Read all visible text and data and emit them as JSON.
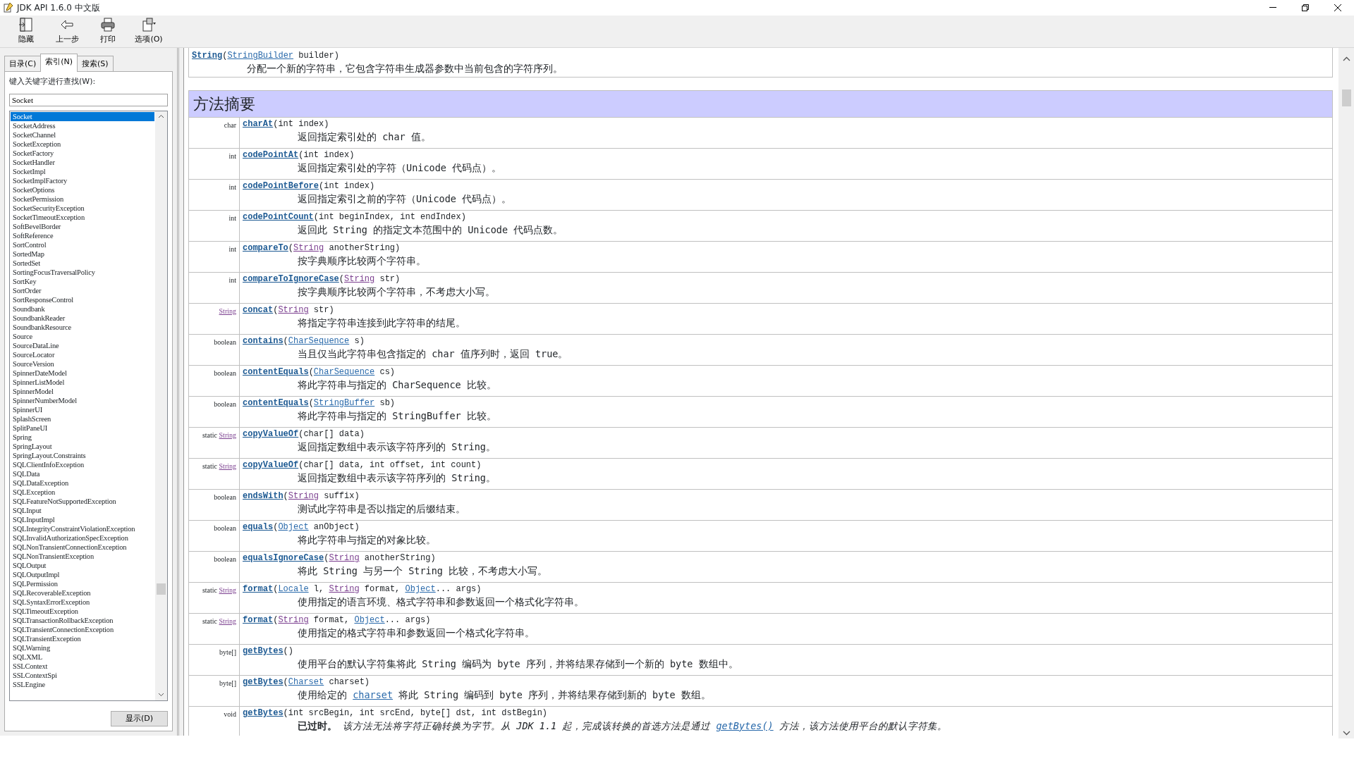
{
  "window": {
    "title": "JDK API 1.6.0 中文版"
  },
  "toolbar": [
    {
      "label": "隐藏",
      "kind": "hide"
    },
    {
      "label": "上一步",
      "kind": "back"
    },
    {
      "label": "打印",
      "kind": "print"
    },
    {
      "label": "选项(O)",
      "kind": "options"
    }
  ],
  "tabs": [
    {
      "label": "目录(C)",
      "selected": false
    },
    {
      "label": "索引(N)",
      "selected": true
    },
    {
      "label": "搜索(S)",
      "selected": false
    }
  ],
  "search": {
    "label": "键入关键字进行查找(W):",
    "value": "Socket"
  },
  "index_list": [
    {
      "label": "Socket",
      "selected": true
    },
    {
      "label": "SocketAddress",
      "selected": false
    },
    {
      "label": "SocketChannel",
      "selected": false
    },
    {
      "label": "SocketException",
      "selected": false
    },
    {
      "label": "SocketFactory",
      "selected": false
    },
    {
      "label": "SocketHandler",
      "selected": false
    },
    {
      "label": "SocketImpl",
      "selected": false
    },
    {
      "label": "SocketImplFactory",
      "selected": false
    },
    {
      "label": "SocketOptions",
      "selected": false
    },
    {
      "label": "SocketPermission",
      "selected": false
    },
    {
      "label": "SocketSecurityException",
      "selected": false
    },
    {
      "label": "SocketTimeoutException",
      "selected": false
    },
    {
      "label": "SoftBevelBorder",
      "selected": false
    },
    {
      "label": "SoftReference",
      "selected": false
    },
    {
      "label": "SortControl",
      "selected": false
    },
    {
      "label": "SortedMap",
      "selected": false
    },
    {
      "label": "SortedSet",
      "selected": false
    },
    {
      "label": "SortingFocusTraversalPolicy",
      "selected": false
    },
    {
      "label": "SortKey",
      "selected": false
    },
    {
      "label": "SortOrder",
      "selected": false
    },
    {
      "label": "SortResponseControl",
      "selected": false
    },
    {
      "label": "Soundbank",
      "selected": false
    },
    {
      "label": "SoundbankReader",
      "selected": false
    },
    {
      "label": "SoundbankResource",
      "selected": false
    },
    {
      "label": "Source",
      "selected": false
    },
    {
      "label": "SourceDataLine",
      "selected": false
    },
    {
      "label": "SourceLocator",
      "selected": false
    },
    {
      "label": "SourceVersion",
      "selected": false
    },
    {
      "label": "SpinnerDateModel",
      "selected": false
    },
    {
      "label": "SpinnerListModel",
      "selected": false
    },
    {
      "label": "SpinnerModel",
      "selected": false
    },
    {
      "label": "SpinnerNumberModel",
      "selected": false
    },
    {
      "label": "SpinnerUI",
      "selected": false
    },
    {
      "label": "SplashScreen",
      "selected": false
    },
    {
      "label": "SplitPaneUI",
      "selected": false
    },
    {
      "label": "Spring",
      "selected": false
    },
    {
      "label": "SpringLayout",
      "selected": false
    },
    {
      "label": "SpringLayout.Constraints",
      "selected": false
    },
    {
      "label": "SQLClientInfoException",
      "selected": false
    },
    {
      "label": "SQLData",
      "selected": false
    },
    {
      "label": "SQLDataException",
      "selected": false
    },
    {
      "label": "SQLException",
      "selected": false
    },
    {
      "label": "SQLFeatureNotSupportedException",
      "selected": false
    },
    {
      "label": "SQLInput",
      "selected": false
    },
    {
      "label": "SQLInputImpl",
      "selected": false
    },
    {
      "label": "SQLIntegrityConstraintViolationException",
      "selected": false
    },
    {
      "label": "SQLInvalidAuthorizationSpecException",
      "selected": false
    },
    {
      "label": "SQLNonTransientConnectionException",
      "selected": false
    },
    {
      "label": "SQLNonTransientException",
      "selected": false
    },
    {
      "label": "SQLOutput",
      "selected": false
    },
    {
      "label": "SQLOutputImpl",
      "selected": false
    },
    {
      "label": "SQLPermission",
      "selected": false
    },
    {
      "label": "SQLRecoverableException",
      "selected": false
    },
    {
      "label": "SQLSyntaxErrorException",
      "selected": false
    },
    {
      "label": "SQLTimeoutException",
      "selected": false
    },
    {
      "label": "SQLTransactionRollbackException",
      "selected": false
    },
    {
      "label": "SQLTransientConnectionException",
      "selected": false
    },
    {
      "label": "SQLTransientException",
      "selected": false
    },
    {
      "label": "SQLWarning",
      "selected": false
    },
    {
      "label": "SQLXML",
      "selected": false
    },
    {
      "label": "SSLContext",
      "selected": false
    },
    {
      "label": "SSLContextSpi",
      "selected": false
    },
    {
      "label": "SSLEngine",
      "selected": false
    }
  ],
  "display_button": "显示(D)",
  "constructor_row": {
    "signature": [
      {
        "kind": "method",
        "text": "String"
      },
      {
        "kind": "text",
        "text": "("
      },
      {
        "kind": "link",
        "text": "StringBuilder"
      },
      {
        "kind": "text",
        "text": " builder)"
      }
    ],
    "description": [
      {
        "kind": "text",
        "text": "分配一个新的字符串，它包含字符串生成器参数中当前包含的字符序列。"
      }
    ]
  },
  "section_heading": "方法摘要",
  "methods": [
    {
      "modifier": [
        {
          "kind": "text",
          "text": "char"
        }
      ],
      "signature": [
        {
          "kind": "method",
          "text": "charAt"
        },
        {
          "kind": "text",
          "text": "(int index)"
        }
      ],
      "description": [
        {
          "kind": "text",
          "text": "返回指定索引处的 char 值。"
        }
      ]
    },
    {
      "modifier": [
        {
          "kind": "text",
          "text": "int"
        }
      ],
      "signature": [
        {
          "kind": "method",
          "text": "codePointAt"
        },
        {
          "kind": "text",
          "text": "(int index)"
        }
      ],
      "description": [
        {
          "kind": "text",
          "text": "返回指定索引处的字符（Unicode 代码点）。"
        }
      ]
    },
    {
      "modifier": [
        {
          "kind": "text",
          "text": "int"
        }
      ],
      "signature": [
        {
          "kind": "method",
          "text": "codePointBefore"
        },
        {
          "kind": "text",
          "text": "(int index)"
        }
      ],
      "description": [
        {
          "kind": "text",
          "text": "返回指定索引之前的字符（Unicode 代码点）。"
        }
      ]
    },
    {
      "modifier": [
        {
          "kind": "text",
          "text": "int"
        }
      ],
      "signature": [
        {
          "kind": "method",
          "text": "codePointCount"
        },
        {
          "kind": "text",
          "text": "(int beginIndex, int endIndex)"
        }
      ],
      "description": [
        {
          "kind": "text",
          "text": "返回此 String 的指定文本范围中的 Unicode 代码点数。"
        }
      ]
    },
    {
      "modifier": [
        {
          "kind": "text",
          "text": "int"
        }
      ],
      "signature": [
        {
          "kind": "method",
          "text": "compareTo"
        },
        {
          "kind": "text",
          "text": "("
        },
        {
          "kind": "visited",
          "text": "String"
        },
        {
          "kind": "text",
          "text": " anotherString)"
        }
      ],
      "description": [
        {
          "kind": "text",
          "text": "按字典顺序比较两个字符串。"
        }
      ]
    },
    {
      "modifier": [
        {
          "kind": "text",
          "text": "int"
        }
      ],
      "signature": [
        {
          "kind": "method",
          "text": "compareToIgnoreCase"
        },
        {
          "kind": "text",
          "text": "("
        },
        {
          "kind": "visited",
          "text": "String"
        },
        {
          "kind": "text",
          "text": " str)"
        }
      ],
      "description": [
        {
          "kind": "text",
          "text": "按字典顺序比较两个字符串，不考虑大小写。"
        }
      ]
    },
    {
      "modifier": [
        {
          "kind": "visited",
          "text": "String"
        }
      ],
      "signature": [
        {
          "kind": "method",
          "text": "concat"
        },
        {
          "kind": "text",
          "text": "("
        },
        {
          "kind": "visited",
          "text": "String"
        },
        {
          "kind": "text",
          "text": " str)"
        }
      ],
      "description": [
        {
          "kind": "text",
          "text": "将指定字符串连接到此字符串的结尾。"
        }
      ]
    },
    {
      "modifier": [
        {
          "kind": "text",
          "text": "boolean"
        }
      ],
      "signature": [
        {
          "kind": "method",
          "text": "contains"
        },
        {
          "kind": "text",
          "text": "("
        },
        {
          "kind": "link",
          "text": "CharSequence"
        },
        {
          "kind": "text",
          "text": " s)"
        }
      ],
      "description": [
        {
          "kind": "text",
          "text": "当且仅当此字符串包含指定的 char 值序列时，返回 true。"
        }
      ]
    },
    {
      "modifier": [
        {
          "kind": "text",
          "text": "boolean"
        }
      ],
      "signature": [
        {
          "kind": "method",
          "text": "contentEquals"
        },
        {
          "kind": "text",
          "text": "("
        },
        {
          "kind": "link",
          "text": "CharSequence"
        },
        {
          "kind": "text",
          "text": " cs)"
        }
      ],
      "description": [
        {
          "kind": "text",
          "text": "将此字符串与指定的 CharSequence 比较。"
        }
      ]
    },
    {
      "modifier": [
        {
          "kind": "text",
          "text": "boolean"
        }
      ],
      "signature": [
        {
          "kind": "method",
          "text": "contentEquals"
        },
        {
          "kind": "text",
          "text": "("
        },
        {
          "kind": "link",
          "text": "StringBuffer"
        },
        {
          "kind": "text",
          "text": " sb)"
        }
      ],
      "description": [
        {
          "kind": "text",
          "text": "将此字符串与指定的 StringBuffer 比较。"
        }
      ]
    },
    {
      "modifier": [
        {
          "kind": "text",
          "text": "static "
        },
        {
          "kind": "visited",
          "text": "String"
        }
      ],
      "signature": [
        {
          "kind": "method",
          "text": "copyValueOf"
        },
        {
          "kind": "text",
          "text": "(char[] data)"
        }
      ],
      "description": [
        {
          "kind": "text",
          "text": "返回指定数组中表示该字符序列的 String。"
        }
      ]
    },
    {
      "modifier": [
        {
          "kind": "text",
          "text": "static "
        },
        {
          "kind": "visited",
          "text": "String"
        }
      ],
      "signature": [
        {
          "kind": "method",
          "text": "copyValueOf"
        },
        {
          "kind": "text",
          "text": "(char[] data, int offset, int count)"
        }
      ],
      "description": [
        {
          "kind": "text",
          "text": "返回指定数组中表示该字符序列的 String。"
        }
      ]
    },
    {
      "modifier": [
        {
          "kind": "text",
          "text": "boolean"
        }
      ],
      "signature": [
        {
          "kind": "method",
          "text": "endsWith"
        },
        {
          "kind": "text",
          "text": "("
        },
        {
          "kind": "visited",
          "text": "String"
        },
        {
          "kind": "text",
          "text": " suffix)"
        }
      ],
      "description": [
        {
          "kind": "text",
          "text": "测试此字符串是否以指定的后缀结束。"
        }
      ]
    },
    {
      "modifier": [
        {
          "kind": "text",
          "text": "boolean"
        }
      ],
      "signature": [
        {
          "kind": "method",
          "text": "equals"
        },
        {
          "kind": "text",
          "text": "("
        },
        {
          "kind": "link",
          "text": "Object"
        },
        {
          "kind": "text",
          "text": " anObject)"
        }
      ],
      "description": [
        {
          "kind": "text",
          "text": "将此字符串与指定的对象比较。"
        }
      ]
    },
    {
      "modifier": [
        {
          "kind": "text",
          "text": "boolean"
        }
      ],
      "signature": [
        {
          "kind": "method",
          "text": "equalsIgnoreCase"
        },
        {
          "kind": "text",
          "text": "("
        },
        {
          "kind": "visited",
          "text": "String"
        },
        {
          "kind": "text",
          "text": " anotherString)"
        }
      ],
      "description": [
        {
          "kind": "text",
          "text": "将此 String 与另一个 String 比较，不考虑大小写。"
        }
      ]
    },
    {
      "modifier": [
        {
          "kind": "text",
          "text": "static "
        },
        {
          "kind": "visited",
          "text": "String"
        }
      ],
      "signature": [
        {
          "kind": "method",
          "text": "format"
        },
        {
          "kind": "text",
          "text": "("
        },
        {
          "kind": "link",
          "text": "Locale"
        },
        {
          "kind": "text",
          "text": " l, "
        },
        {
          "kind": "visited",
          "text": "String"
        },
        {
          "kind": "text",
          "text": " format, "
        },
        {
          "kind": "link",
          "text": "Object"
        },
        {
          "kind": "text",
          "text": "... args)"
        }
      ],
      "description": [
        {
          "kind": "text",
          "text": "使用指定的语言环境、格式字符串和参数返回一个格式化字符串。"
        }
      ]
    },
    {
      "modifier": [
        {
          "kind": "text",
          "text": "static "
        },
        {
          "kind": "visited",
          "text": "String"
        }
      ],
      "signature": [
        {
          "kind": "method",
          "text": "format"
        },
        {
          "kind": "text",
          "text": "("
        },
        {
          "kind": "visited",
          "text": "String"
        },
        {
          "kind": "text",
          "text": " format, "
        },
        {
          "kind": "link",
          "text": "Object"
        },
        {
          "kind": "text",
          "text": "... args)"
        }
      ],
      "description": [
        {
          "kind": "text",
          "text": "使用指定的格式字符串和参数返回一个格式化字符串。"
        }
      ]
    },
    {
      "modifier": [
        {
          "kind": "text",
          "text": "byte[]"
        }
      ],
      "signature": [
        {
          "kind": "method",
          "text": "getBytes"
        },
        {
          "kind": "text",
          "text": "()"
        }
      ],
      "description": [
        {
          "kind": "text",
          "text": "使用平台的默认字符集将此 String 编码为 byte 序列，并将结果存储到一个新的 byte 数组中。"
        }
      ]
    },
    {
      "modifier": [
        {
          "kind": "text",
          "text": "byte[]"
        }
      ],
      "signature": [
        {
          "kind": "method",
          "text": "getBytes"
        },
        {
          "kind": "text",
          "text": "("
        },
        {
          "kind": "link",
          "text": "Charset"
        },
        {
          "kind": "text",
          "text": " charset)"
        }
      ],
      "description": [
        {
          "kind": "text",
          "text": "使用给定的 "
        },
        {
          "kind": "link",
          "text": "charset"
        },
        {
          "kind": "text",
          "text": " 将此 String 编码到 byte 序列，并将结果存储到新的 byte 数组。"
        }
      ]
    },
    {
      "modifier": [
        {
          "kind": "text",
          "text": "void"
        }
      ],
      "signature": [
        {
          "kind": "method",
          "text": "getBytes"
        },
        {
          "kind": "text",
          "text": "(int srcBegin, int srcEnd, byte[] dst, int dstBegin)"
        }
      ],
      "description": [
        {
          "kind": "bold",
          "text": "已过时。"
        },
        {
          "kind": "italic",
          "text": " 该方法无法将字符正确转换为字节。从 JDK 1.1 起，完成该转换的首选方法是通过 "
        },
        {
          "kind": "italic-link",
          "text": "getBytes()"
        },
        {
          "kind": "italic",
          "text": " 方法，该方法使用平台的默认字符集。"
        }
      ]
    }
  ]
}
